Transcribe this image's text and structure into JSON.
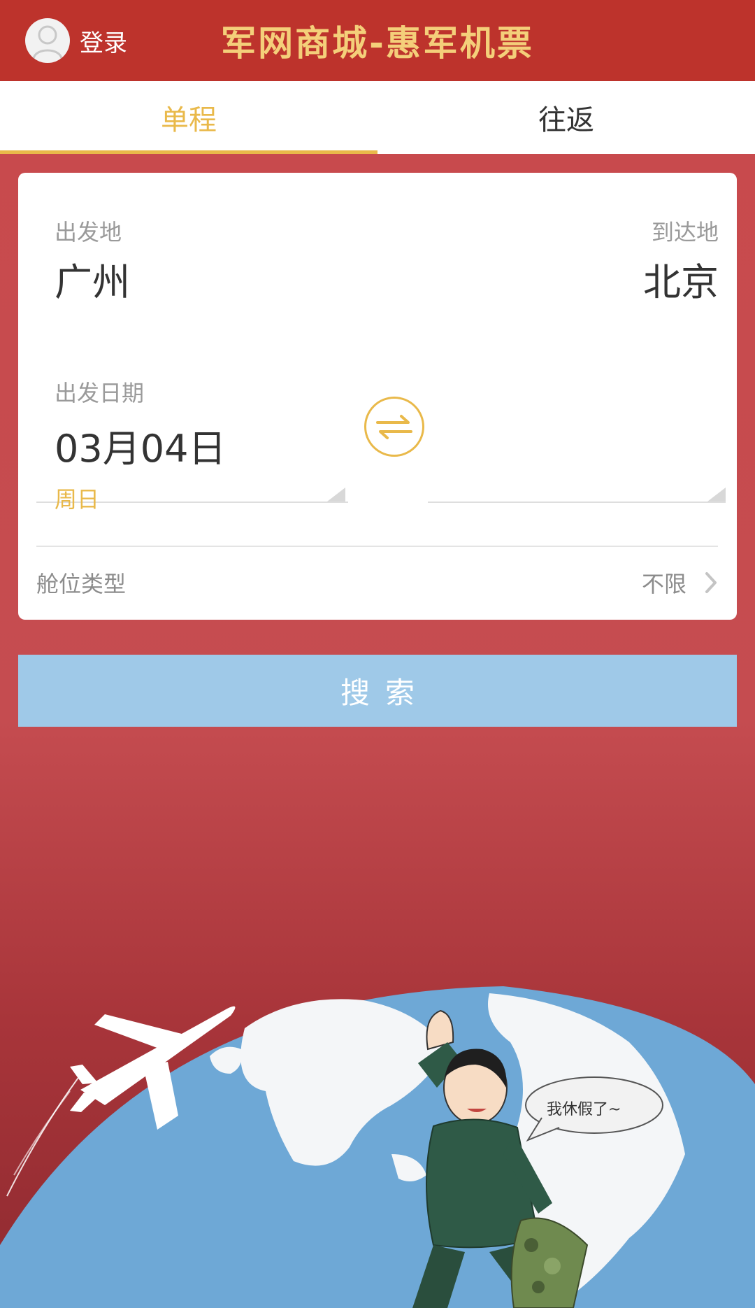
{
  "header": {
    "login_label": "登录",
    "title": "军网商城-惠军机票"
  },
  "tabs": [
    {
      "label": "单程",
      "active": true
    },
    {
      "label": "往返",
      "active": false
    }
  ],
  "form": {
    "origin_label": "出发地",
    "origin_value": "广州",
    "destination_label": "到达地",
    "destination_value": "北京",
    "date_label": "出发日期",
    "date_value": "03月04日",
    "weekday": "周日",
    "cabin_label": "舱位类型",
    "cabin_value": "不限"
  },
  "search_label": "搜索",
  "illustration": {
    "speech_bubble": "我休假了~"
  },
  "colors": {
    "header_bg": "#bd332c",
    "accent": "#e9b94a",
    "title_gold": "#f4cf7a",
    "search_bg": "#9fc9e8",
    "globe": "#6ea8d6"
  }
}
